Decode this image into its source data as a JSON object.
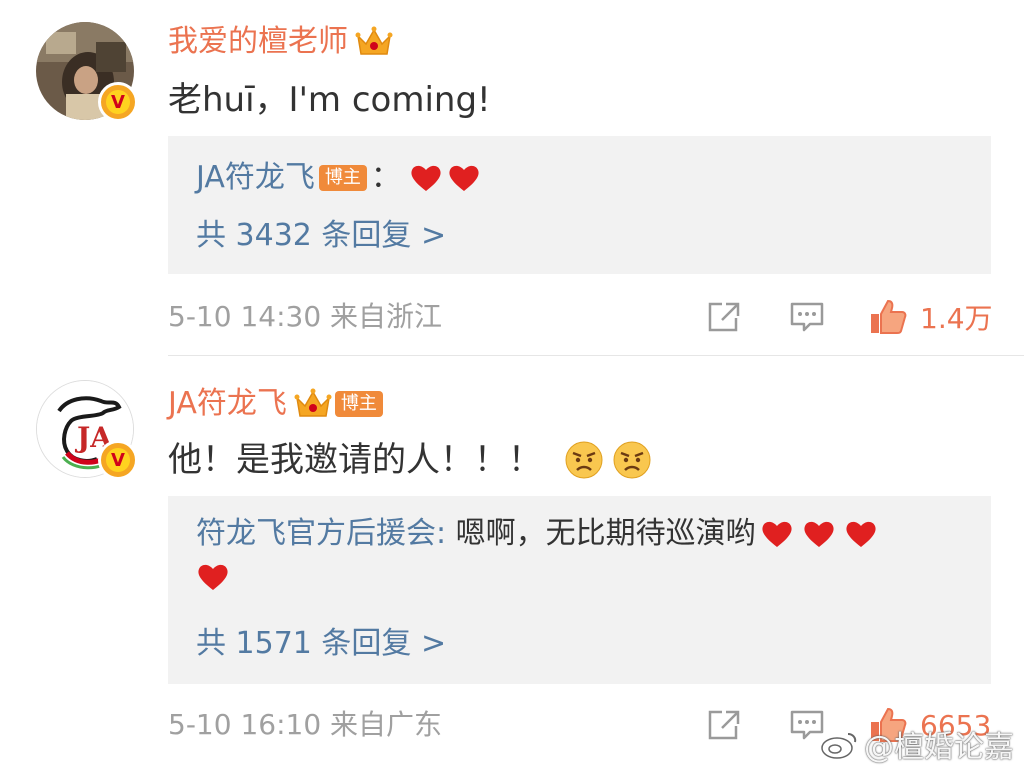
{
  "comments": [
    {
      "username": "我爱的檀老师",
      "text": "老huī，I'm coming!",
      "reply": {
        "user": "JA符龙飞",
        "host_tag": "博主",
        "separator": "：",
        "content_icons": [
          "heart-icon",
          "heart-icon"
        ]
      },
      "reply_more": "共 3432 条回复 >",
      "meta": "5-10 14:30  来自浙江",
      "likes": "1.4万"
    },
    {
      "username": "JA符龙飞",
      "host_tag": "博主",
      "text": "他！是我邀请的人！！！",
      "text_icons": [
        "angry-face-icon",
        "angry-face-icon"
      ],
      "reply": {
        "user": "符龙飞官方后援会",
        "separator": ": ",
        "content": "嗯啊，无比期待巡演哟",
        "content_icons": [
          "heart-icon",
          "heart-icon",
          "heart-icon",
          "heart-icon"
        ]
      },
      "reply_more": "共 1571 条回复 >",
      "meta": "5-10 16:10  来自广东",
      "likes": "6653"
    }
  ],
  "watermark": "@檀婚论嘉",
  "colors": {
    "accent": "#eb7350",
    "link": "#537aa2",
    "meta": "#a0a0a0",
    "reply_bg": "#f2f2f2"
  }
}
